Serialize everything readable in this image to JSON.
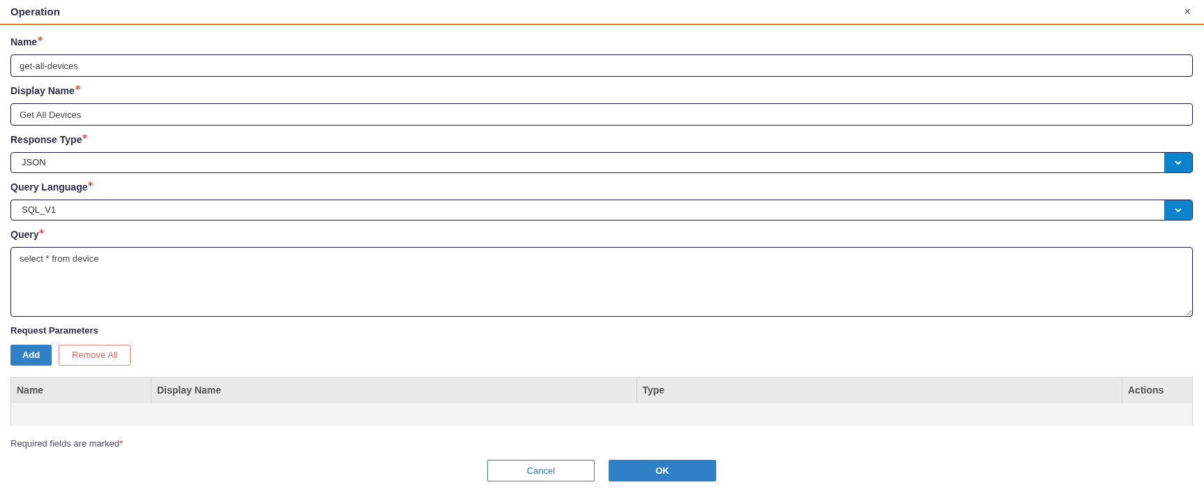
{
  "dialog": {
    "title": "Operation",
    "close": "×"
  },
  "fields": [
    {
      "kind": "text",
      "label": "Name",
      "required": true,
      "value": "get-all-devices"
    },
    {
      "kind": "text",
      "label": "Display Name",
      "required": true,
      "value": "Get All Devices"
    },
    {
      "kind": "select",
      "label": "Response Type",
      "required": true,
      "value": "JSON"
    },
    {
      "kind": "select",
      "label": "Query Language",
      "required": true,
      "value": "SQL_V1"
    },
    {
      "kind": "textarea",
      "label": "Query",
      "required": true,
      "value": "select * from device"
    }
  ],
  "request_parameters": {
    "title": "Request Parameters",
    "buttons": [
      {
        "kind": "primary",
        "label": "Add"
      },
      {
        "kind": "danger",
        "label": "Remove All"
      }
    ],
    "table": {
      "columns": [
        "Name",
        "Display Name",
        "Type",
        "Actions"
      ]
    }
  },
  "required_note": {
    "text": "Required fields are marked",
    "mark": "*"
  },
  "footer_buttons": [
    {
      "kind": "secondary",
      "label": "Cancel"
    },
    {
      "kind": "primary",
      "label": "OK"
    }
  ]
}
